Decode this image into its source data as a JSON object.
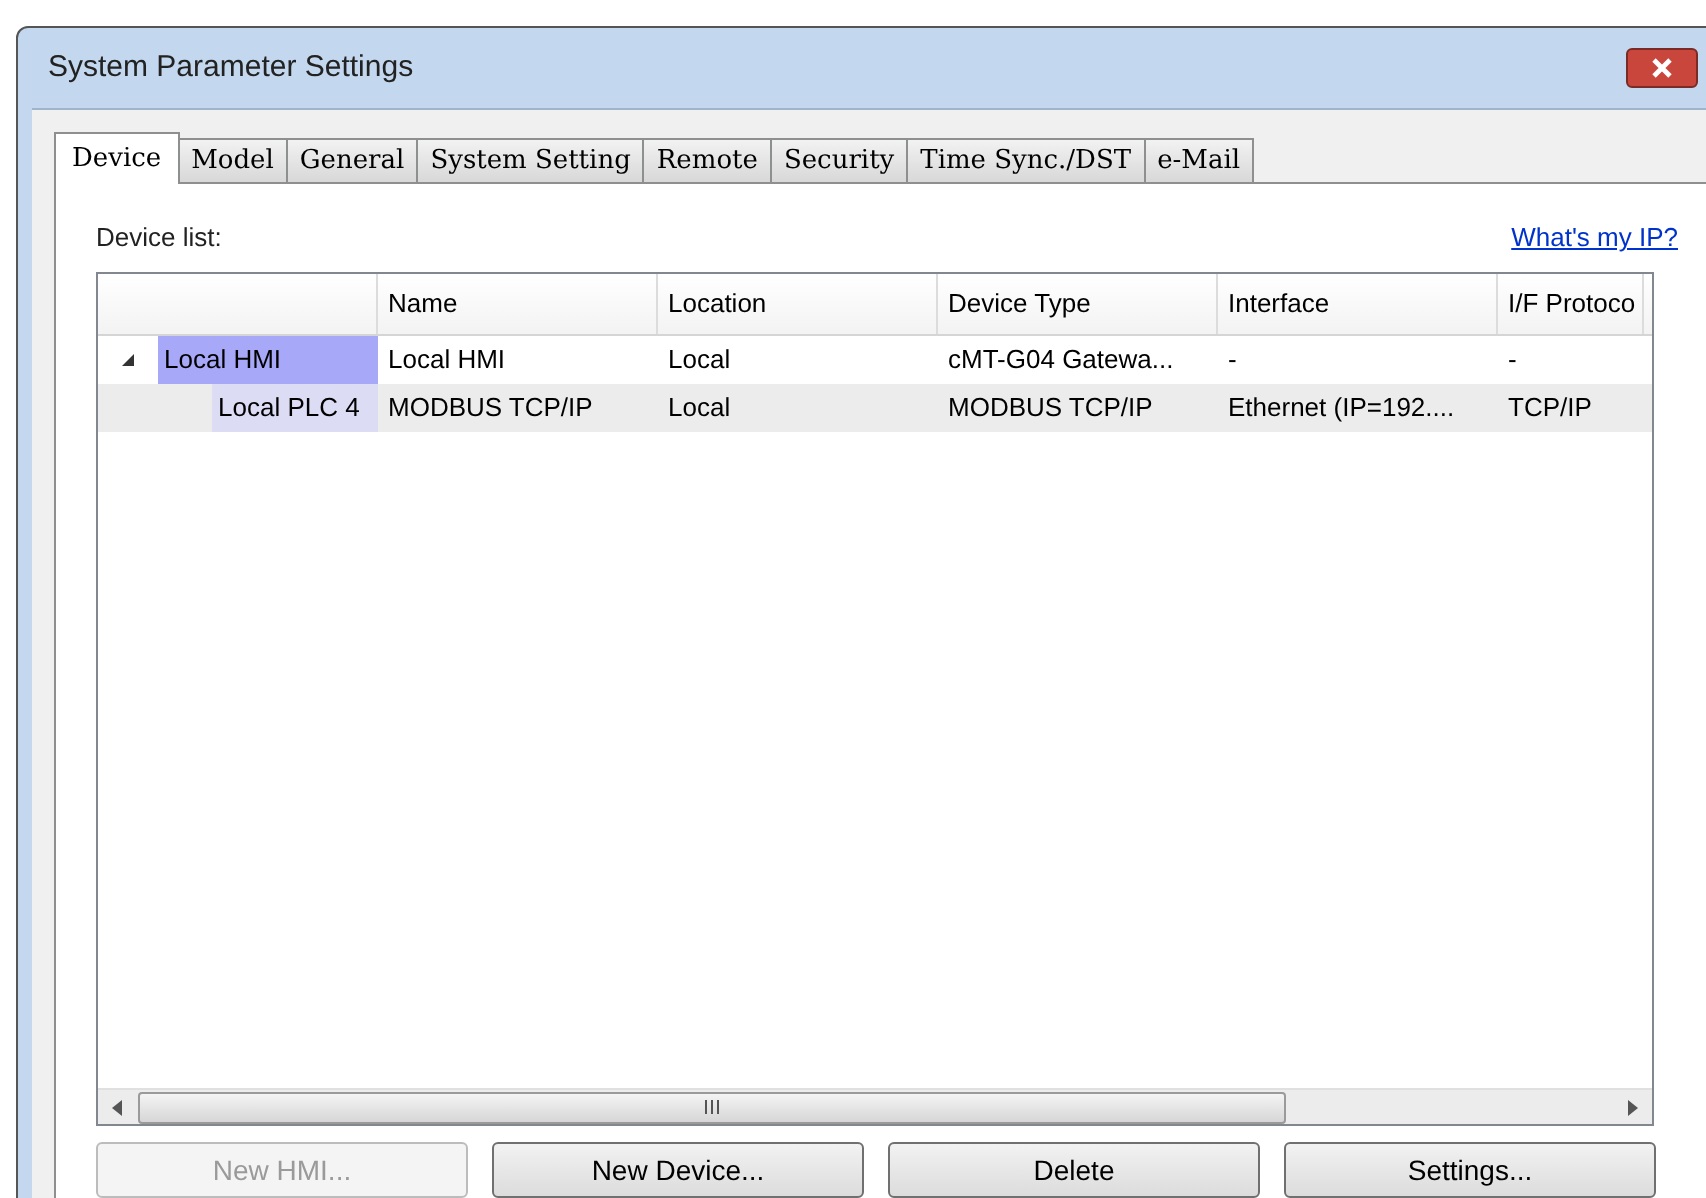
{
  "window": {
    "title": "System Parameter Settings"
  },
  "tabs": [
    {
      "label": "Device",
      "selected": true
    },
    {
      "label": "Model",
      "selected": false
    },
    {
      "label": "General",
      "selected": false
    },
    {
      "label": "System Setting",
      "selected": false
    },
    {
      "label": "Remote",
      "selected": false
    },
    {
      "label": "Security",
      "selected": false
    },
    {
      "label": "Time Sync./DST",
      "selected": false
    },
    {
      "label": "e-Mail",
      "selected": false
    }
  ],
  "device_list": {
    "label": "Device list:",
    "link": "What's my IP?"
  },
  "table": {
    "columns": [
      "Name",
      "Location",
      "Device Type",
      "Interface",
      "I/F Protoco"
    ],
    "rows": [
      {
        "label": "Local HMI",
        "expanded": true,
        "selected": true,
        "hovered": false,
        "cells": [
          "Local HMI",
          "Local",
          "cMT-G04 Gatewa...",
          "-",
          "-"
        ],
        "children": [
          {
            "label": "Local PLC 4",
            "selected": false,
            "hovered": true,
            "cells": [
              "MODBUS TCP/IP",
              "Local",
              "MODBUS TCP/IP",
              "Ethernet (IP=192....",
              "TCP/IP"
            ]
          }
        ]
      }
    ]
  },
  "buttons": [
    {
      "label": "New HMI...",
      "disabled": true
    },
    {
      "label": "New Device...",
      "disabled": false
    },
    {
      "label": "Delete",
      "disabled": false
    },
    {
      "label": "Settings...",
      "disabled": false
    }
  ]
}
